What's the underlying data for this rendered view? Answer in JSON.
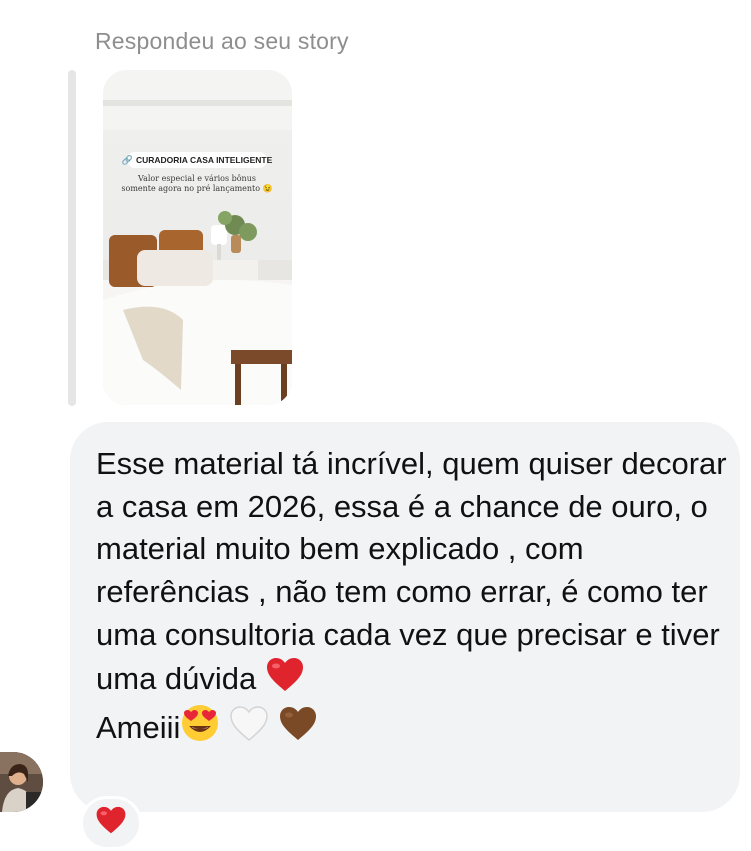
{
  "reply_header": {
    "label": "Respondeu ao seu story"
  },
  "story": {
    "sticker_label": "CURADORIA CASA INTELIGENTE",
    "caption": "Valor especial e vários bônus somente agora no pré lançamento 😉"
  },
  "message": {
    "text": "Esse material tá incrível, quem quiser decorar a casa em 2026, essa é a chance de ouro, o material muito bem explicado , com referências , não tem como errar, é como ter uma consultoria cada vez que precisar e tiver uma dúvida",
    "line2_text": "Ameiii",
    "emojis": [
      "red-heart",
      "heart-eyes",
      "white-heart",
      "brown-heart"
    ]
  },
  "reaction": {
    "emoji": "red-heart"
  }
}
